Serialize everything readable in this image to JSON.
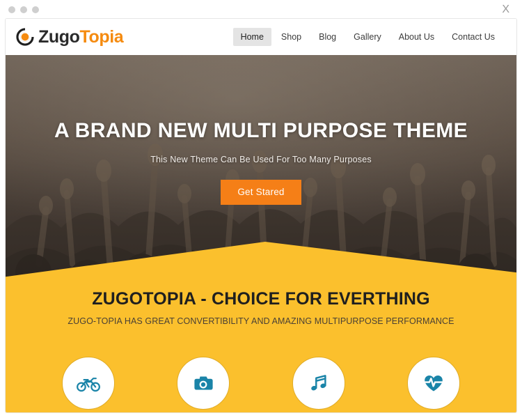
{
  "window": {
    "close_label": "X",
    "traffic_dots": 3
  },
  "header": {
    "logo": {
      "icon": "target-circle-icon",
      "text_primary": "Zugo",
      "text_accent": "Topia",
      "accent_color": "#f58b10",
      "primary_color": "#2b2b2b"
    },
    "nav": [
      {
        "label": "Home",
        "active": true
      },
      {
        "label": "Shop",
        "active": false
      },
      {
        "label": "Blog",
        "active": false
      },
      {
        "label": "Gallery",
        "active": false
      },
      {
        "label": "About Us",
        "active": false
      },
      {
        "label": "Contact Us",
        "active": false
      }
    ]
  },
  "hero": {
    "title": "A BRAND NEW MULTI PURPOSE THEME",
    "subtitle": "This New Theme Can Be Used For Too Many Purposes",
    "cta_label": "Get Stared",
    "cta_color": "#f57f17",
    "background": "concert-crowd-raised-hands-photo"
  },
  "feature_band": {
    "background_color": "#fbc02d",
    "title": "ZUGOTOPIA - CHOICE FOR EVERTHING",
    "subtitle": "ZUGO-TOPIA HAS GREAT CONVERTIBILITY AND AMAZING MULTIPURPOSE PERFORMANCE",
    "icon_color": "#1a84a8",
    "items": [
      {
        "icon": "motorcycle-icon"
      },
      {
        "icon": "camera-icon"
      },
      {
        "icon": "music-note-icon"
      },
      {
        "icon": "heartbeat-icon"
      }
    ]
  }
}
